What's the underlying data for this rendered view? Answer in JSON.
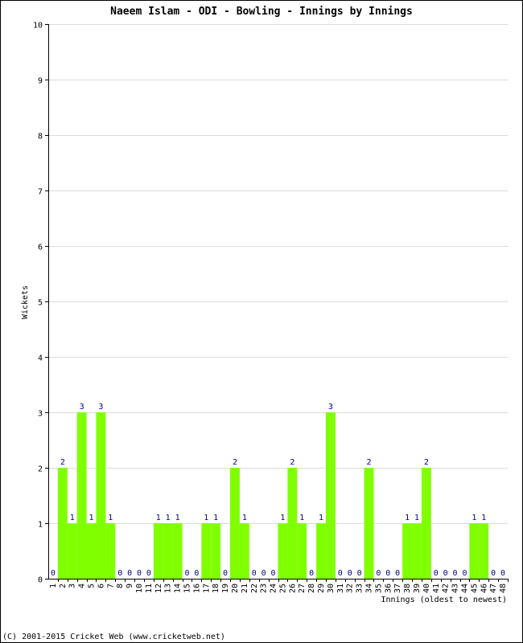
{
  "chart_data": {
    "type": "bar",
    "title": "Naeem Islam - ODI - Bowling - Innings by Innings",
    "xlabel": "Innings (oldest to newest)",
    "ylabel": "Wickets",
    "ylim": [
      0,
      10
    ],
    "yticks": [
      0,
      1,
      2,
      3,
      4,
      5,
      6,
      7,
      8,
      9,
      10
    ],
    "grid": true,
    "bar_color": "#80ff00",
    "label_color": "#000080",
    "categories": [
      "1",
      "2",
      "3",
      "4",
      "5",
      "6",
      "7",
      "8",
      "9",
      "10",
      "11",
      "12",
      "13",
      "14",
      "15",
      "16",
      "17",
      "18",
      "19",
      "20",
      "21",
      "22",
      "23",
      "24",
      "25",
      "26",
      "27",
      "28",
      "29",
      "30",
      "31",
      "32",
      "33",
      "34",
      "35",
      "36",
      "37",
      "38",
      "39",
      "40",
      "41",
      "42",
      "43",
      "44",
      "45",
      "46",
      "47",
      "48"
    ],
    "values": [
      0,
      2,
      1,
      3,
      1,
      3,
      1,
      0,
      0,
      0,
      0,
      1,
      1,
      1,
      0,
      0,
      1,
      1,
      0,
      2,
      1,
      0,
      0,
      0,
      1,
      2,
      1,
      0,
      1,
      3,
      0,
      0,
      0,
      2,
      0,
      0,
      0,
      1,
      1,
      2,
      0,
      0,
      0,
      0,
      1,
      1,
      0,
      0
    ]
  },
  "footer": "(C) 2001-2015 Cricket Web (www.cricketweb.net)"
}
